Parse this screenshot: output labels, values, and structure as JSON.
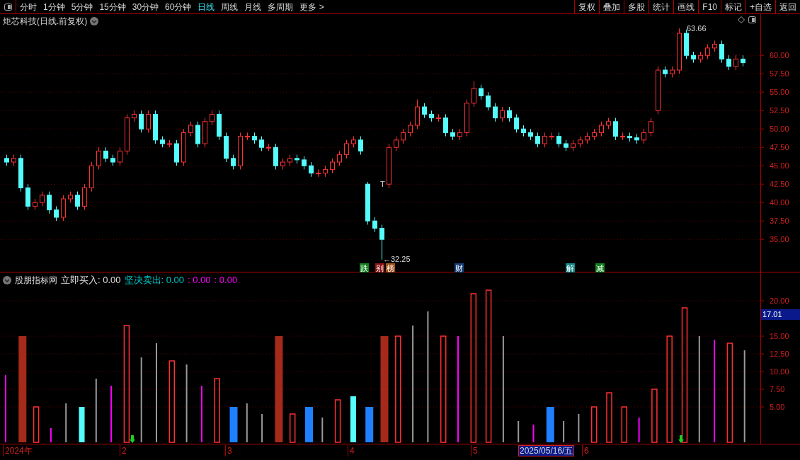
{
  "toolbar": {
    "periods": [
      {
        "label": "分时",
        "selected": false
      },
      {
        "label": "1分钟",
        "selected": false
      },
      {
        "label": "5分钟",
        "selected": false
      },
      {
        "label": "15分钟",
        "selected": false
      },
      {
        "label": "30分钟",
        "selected": false
      },
      {
        "label": "60分钟",
        "selected": false
      },
      {
        "label": "日线",
        "selected": true
      },
      {
        "label": "周线",
        "selected": false
      },
      {
        "label": "月线",
        "selected": false
      },
      {
        "label": "多周期",
        "selected": false
      },
      {
        "label": "更多 >",
        "selected": false
      }
    ],
    "actions": [
      "复权",
      "叠加",
      "多股",
      "统计",
      "画线",
      "F10",
      "标记",
      "+自选",
      "返回"
    ]
  },
  "stock_title": "炬芯科技(日线.前复权)",
  "price_chart": {
    "chart_data": {
      "type": "candlestick",
      "ylim": [
        30.5,
        65.6
      ],
      "grid": true,
      "yticks": [
        {
          "value": 35,
          "label": "35.00"
        },
        {
          "value": 37.5,
          "label": "37.50"
        },
        {
          "value": 40,
          "label": "40.00"
        },
        {
          "value": 42.5,
          "label": "42.50"
        },
        {
          "value": 45,
          "label": "45.00"
        },
        {
          "value": 47.5,
          "label": "47.50"
        },
        {
          "value": 50,
          "label": "50.00"
        },
        {
          "value": 52.5,
          "label": "52.50"
        },
        {
          "value": 55,
          "label": "55.00"
        },
        {
          "value": 57.5,
          "label": "57.50"
        },
        {
          "value": 60,
          "label": "60.00"
        }
      ],
      "ohlc": [
        [
          46,
          46.5,
          45,
          45.5
        ],
        [
          45.5,
          46.5,
          45,
          46
        ],
        [
          46,
          46.5,
          41.5,
          42
        ],
        [
          42,
          42.5,
          39,
          39.5
        ],
        [
          39.5,
          40.5,
          39,
          40
        ],
        [
          40,
          41.5,
          39.5,
          41
        ],
        [
          41,
          41.5,
          38.5,
          39
        ],
        [
          39,
          39.5,
          37.5,
          38
        ],
        [
          38,
          41,
          37.5,
          40.5
        ],
        [
          40.5,
          41.5,
          40,
          41
        ],
        [
          41,
          41.5,
          39,
          39.5
        ],
        [
          39.5,
          42.5,
          39,
          42
        ],
        [
          42,
          45.5,
          41.5,
          45
        ],
        [
          45,
          47.5,
          44.5,
          47
        ],
        [
          47,
          47.5,
          45.5,
          46
        ],
        [
          46,
          46.5,
          45,
          45.5
        ],
        [
          45.5,
          47.5,
          45,
          47
        ],
        [
          47,
          52,
          46.5,
          51.5
        ],
        [
          51.5,
          52.5,
          51,
          52
        ],
        [
          52,
          52.5,
          49.5,
          50
        ],
        [
          50,
          52.5,
          49.5,
          52
        ],
        [
          52,
          52.5,
          48,
          48.5
        ],
        [
          48.5,
          49,
          47.5,
          48
        ],
        [
          48,
          48.5,
          47.5,
          48
        ],
        [
          48,
          48.5,
          45,
          45.5
        ],
        [
          45.5,
          50,
          45,
          49.5
        ],
        [
          49.5,
          51,
          49,
          50.5
        ],
        [
          50.5,
          51,
          47.5,
          48
        ],
        [
          48,
          51.5,
          47.5,
          51
        ],
        [
          51,
          52.5,
          50.5,
          52
        ],
        [
          52,
          52.5,
          48.5,
          49
        ],
        [
          49,
          49.5,
          45.5,
          46
        ],
        [
          46,
          46.5,
          44.5,
          45
        ],
        [
          45,
          49.5,
          44.5,
          49
        ],
        [
          49,
          49.5,
          48.5,
          49
        ],
        [
          49,
          49.5,
          48,
          48.5
        ],
        [
          48.5,
          49,
          47,
          47.5
        ],
        [
          47.5,
          48,
          47,
          47.5
        ],
        [
          47.5,
          48,
          44.5,
          45
        ],
        [
          45,
          46,
          44.5,
          45.5
        ],
        [
          45.5,
          46.5,
          45,
          46
        ],
        [
          46,
          46.5,
          45.3,
          45.8
        ],
        [
          45.8,
          46.3,
          44.5,
          45
        ],
        [
          45,
          45.5,
          43.5,
          44
        ],
        [
          44,
          44.5,
          43.5,
          44
        ],
        [
          44,
          45,
          43.5,
          44.5
        ],
        [
          44.5,
          46,
          44,
          45.5
        ],
        [
          45.5,
          47,
          45,
          46.5
        ],
        [
          46.5,
          48.5,
          46,
          48
        ],
        [
          48,
          49,
          47.5,
          48.5
        ],
        [
          48.5,
          49,
          46.5,
          47
        ],
        [
          42.5,
          42.8,
          37,
          37.5
        ],
        [
          37.5,
          38,
          36,
          36.5
        ],
        [
          36.5,
          37,
          32.25,
          35
        ],
        [
          42.5,
          48,
          42,
          47.5
        ],
        [
          47.5,
          49,
          47,
          48.5
        ],
        [
          48.5,
          50,
          48,
          49.5
        ],
        [
          49.5,
          51,
          49,
          50.5
        ],
        [
          50.5,
          54,
          50,
          53
        ],
        [
          53,
          53.5,
          51.5,
          52
        ],
        [
          52,
          52.5,
          51,
          51.5
        ],
        [
          51.5,
          52,
          51,
          51.5
        ],
        [
          51.5,
          52,
          49,
          49.5
        ],
        [
          49.5,
          50,
          48.5,
          49
        ],
        [
          49,
          50,
          48.5,
          49.5
        ],
        [
          49.5,
          54,
          49,
          53.5
        ],
        [
          53.5,
          56.5,
          53,
          55.5
        ],
        [
          55.5,
          56,
          54,
          54.5
        ],
        [
          54.5,
          55,
          52.5,
          53
        ],
        [
          53,
          53.5,
          51,
          51.5
        ],
        [
          51.5,
          53,
          51,
          52.5
        ],
        [
          52.5,
          53,
          51,
          51.5
        ],
        [
          51.5,
          52,
          49.5,
          50
        ],
        [
          50,
          50.5,
          49,
          49.5
        ],
        [
          49.5,
          50,
          48.5,
          49
        ],
        [
          49,
          49.5,
          47.5,
          48
        ],
        [
          48,
          49.5,
          47.5,
          49
        ],
        [
          49,
          49.5,
          48.5,
          49
        ],
        [
          49,
          49.5,
          47.5,
          48
        ],
        [
          48,
          48.5,
          47,
          47.5
        ],
        [
          47.5,
          48.5,
          47,
          48
        ],
        [
          48,
          49,
          47.5,
          48.5
        ],
        [
          48.5,
          49.5,
          48,
          49
        ],
        [
          49,
          50,
          48.5,
          49.5
        ],
        [
          49.5,
          51,
          49,
          50.5
        ],
        [
          50.5,
          51.5,
          50,
          51
        ],
        [
          51,
          51.5,
          48.5,
          49
        ],
        [
          49,
          49.5,
          48.5,
          49
        ],
        [
          49,
          49.5,
          48.3,
          48.8
        ],
        [
          48.8,
          49.3,
          48,
          48.5
        ],
        [
          48.5,
          50,
          48,
          49.5
        ],
        [
          49.5,
          51.5,
          49,
          51
        ],
        [
          52.5,
          58.5,
          52,
          58
        ],
        [
          58,
          58.5,
          57,
          57.5
        ],
        [
          57.5,
          58.5,
          57,
          58
        ],
        [
          58,
          63.66,
          57.5,
          63
        ],
        [
          63,
          63.5,
          59.5,
          60
        ],
        [
          60,
          60.5,
          59,
          59.5
        ],
        [
          59.5,
          60.5,
          59,
          60
        ],
        [
          60,
          61.5,
          59.5,
          61
        ],
        [
          61,
          62,
          60.5,
          61.5
        ],
        [
          61.5,
          62,
          59,
          59.5
        ],
        [
          59.5,
          60,
          58,
          58.5
        ],
        [
          58.5,
          60,
          58,
          59.5
        ],
        [
          59.5,
          60,
          58.5,
          59
        ]
      ]
    },
    "high_label": "63.66",
    "low_label": "←32.25",
    "mark": "T",
    "tags": [
      {
        "text": "跌",
        "color": "#12801e"
      },
      {
        "text": "别",
        "color": "#8b1414"
      },
      {
        "text": "榜",
        "color": "#a0521a"
      },
      {
        "text": "财",
        "color": "#1a3f7a"
      },
      {
        "text": "解",
        "color": "#168585"
      },
      {
        "text": "减",
        "color": "#12801e"
      }
    ]
  },
  "indicator": {
    "name": "股朋指标网",
    "values": [
      {
        "text": "立即买入: 0.00",
        "color": "#e0e0e0"
      },
      {
        "text": "坚决卖出: 0.00",
        "color": "#00c8c8"
      },
      {
        "text": ": 0.00",
        "color": "#ff00ff"
      },
      {
        "text": ": 0.00",
        "color": "#ff00ff"
      }
    ],
    "current_value": "17.01",
    "chart_data": {
      "type": "bar",
      "ylim": [
        0,
        24
      ],
      "grid": true,
      "yticks": [
        {
          "value": 5,
          "label": "5.00"
        },
        {
          "value": 7.5,
          "label": "7.50"
        },
        {
          "value": 10,
          "label": "10.00"
        },
        {
          "value": 12.5,
          "label": "12.50"
        },
        {
          "value": 15,
          "label": "15.00"
        },
        {
          "value": 20,
          "label": "20.00"
        }
      ],
      "series": [
        {
          "color": "#ff3030",
          "values": [
            null,
            null,
            5,
            null,
            null,
            null,
            null,
            null,
            16.5,
            null,
            null,
            11.5,
            null,
            null,
            9,
            null,
            null,
            null,
            null,
            4,
            null,
            null,
            6,
            null,
            null,
            null,
            15,
            null,
            null,
            15,
            null,
            21,
            21.5,
            null,
            null,
            null,
            null,
            null,
            null,
            5,
            7,
            5,
            null,
            7.5,
            15,
            19,
            null,
            null,
            14,
            null
          ]
        },
        {
          "color": "#9a9a9a",
          "values": [
            null,
            null,
            null,
            null,
            5.5,
            null,
            9,
            null,
            null,
            12,
            14,
            null,
            11,
            null,
            null,
            null,
            5.5,
            4,
            null,
            null,
            null,
            3.5,
            null,
            null,
            null,
            null,
            null,
            16.5,
            18.5,
            null,
            null,
            null,
            null,
            15,
            3,
            null,
            null,
            3,
            4,
            null,
            null,
            null,
            null,
            null,
            null,
            null,
            15,
            null,
            null,
            13
          ]
        },
        {
          "color": "#ff00ff",
          "values": [
            9.5,
            null,
            null,
            2,
            null,
            null,
            null,
            8,
            null,
            null,
            null,
            null,
            null,
            8,
            null,
            null,
            null,
            null,
            null,
            null,
            null,
            null,
            null,
            null,
            null,
            null,
            null,
            null,
            null,
            null,
            15,
            null,
            null,
            null,
            null,
            2.5,
            null,
            null,
            null,
            null,
            null,
            null,
            3.5,
            null,
            null,
            null,
            null,
            14.5,
            null,
            null
          ]
        },
        {
          "color": "#55ffff",
          "values": [
            null,
            null,
            null,
            null,
            null,
            5,
            null,
            null,
            null,
            null,
            null,
            null,
            null,
            null,
            null,
            null,
            null,
            null,
            null,
            null,
            null,
            null,
            null,
            6.5,
            null,
            null,
            null,
            null,
            null,
            null,
            null,
            null,
            null,
            null,
            null,
            null,
            null,
            null,
            null,
            null,
            null,
            null,
            null,
            null,
            null,
            null,
            null,
            null,
            null,
            null
          ]
        },
        {
          "color": "#1e7fff",
          "values": [
            null,
            null,
            null,
            null,
            null,
            null,
            null,
            null,
            null,
            null,
            null,
            null,
            null,
            null,
            null,
            5,
            null,
            null,
            null,
            null,
            5,
            null,
            null,
            null,
            5,
            null,
            null,
            null,
            null,
            null,
            null,
            null,
            null,
            null,
            null,
            null,
            5,
            null,
            null,
            null,
            null,
            null,
            null,
            null,
            null,
            null,
            null,
            null,
            null,
            null
          ]
        },
        {
          "color": "#a52a1a",
          "values": [
            null,
            15,
            null,
            null,
            null,
            null,
            null,
            null,
            null,
            null,
            null,
            null,
            null,
            null,
            null,
            null,
            null,
            null,
            15,
            null,
            null,
            null,
            null,
            null,
            null,
            15,
            null,
            null,
            null,
            null,
            null,
            null,
            null,
            null,
            null,
            null,
            null,
            null,
            null,
            null,
            null,
            null,
            null,
            null,
            null,
            null,
            null,
            null,
            null,
            null
          ]
        }
      ]
    }
  },
  "time_axis": [
    {
      "label": "2024年",
      "highlighted": false
    },
    {
      "label": "2",
      "highlighted": false
    },
    {
      "label": "3",
      "highlighted": false
    },
    {
      "label": "4",
      "highlighted": false
    },
    {
      "label": "5",
      "highlighted": false
    },
    {
      "label": "2025/05/16/五",
      "highlighted": true
    },
    {
      "label": "6",
      "highlighted": false
    }
  ]
}
